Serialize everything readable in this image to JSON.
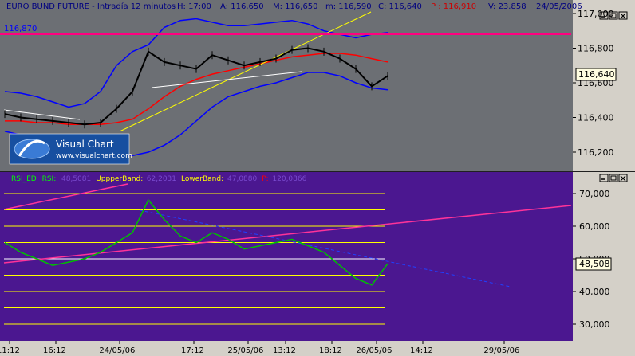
{
  "top_panel": {
    "title": "EURO BUND FUTURE - Intradía 12 minutos",
    "stats": [
      {
        "label": "H:",
        "value": "17:00",
        "color": "#000080"
      },
      {
        "label": "A:",
        "value": "116,650",
        "color": "#000080"
      },
      {
        "label": "M:",
        "value": "116,650",
        "color": "#000080"
      },
      {
        "label": "m:",
        "value": "116,590",
        "color": "#000080"
      },
      {
        "label": "C:",
        "value": "116,640",
        "color": "#000080"
      },
      {
        "label": "P :",
        "value": "116,910",
        "color": "#cc0000"
      },
      {
        "label": "V:",
        "value": "23.858",
        "color": "#000080"
      },
      {
        "label": "",
        "value": "24/05/2006",
        "color": "#000080"
      }
    ],
    "hline_label": "116,870",
    "current_price_label": "116,640",
    "yaxis_ticks": [
      "117,000",
      "116,800",
      "116,600",
      "116,400",
      "116,200"
    ],
    "logo_title": "Visual Chart",
    "logo_url": "www.visualchart.com",
    "colors": {
      "background": "#6c6f74",
      "hline": "#ff0080",
      "upper_band": "#0000ff",
      "ma": "#ff0000",
      "trend": "#ffff00"
    }
  },
  "bottom_panel": {
    "legend": [
      {
        "label": "RSI_ED",
        "value": "",
        "color": "#00ff00"
      },
      {
        "label": "RSI:",
        "value": "48,5081",
        "color": "#00ff00"
      },
      {
        "label": "UppperBand:",
        "value": "62,2031",
        "color": "#ffff00"
      },
      {
        "label": "LowerBand:",
        "value": "47,0880",
        "color": "#ffff00"
      },
      {
        "label": "P:",
        "value": "120,0866",
        "color": "#ff0000"
      }
    ],
    "current_value_label": "48,508",
    "yaxis_ticks": [
      "70,000",
      "60,000",
      "50,000",
      "40,000",
      "30,000"
    ],
    "colors": {
      "background": "#4b1790",
      "rsi": "#00c000",
      "levels": "#ffff00"
    }
  },
  "xaxis_ticks": [
    "11:12",
    "16:12",
    "24/05/06",
    "17:12",
    "25/05/06",
    "13:12",
    "18:12",
    "26/05/06",
    "14:12",
    "29/05/06"
  ],
  "chart_data": [
    {
      "type": "line",
      "title": "EURO BUND FUTURE - Intradía 12 minutos",
      "series": [
        {
          "name": "price",
          "x": [
            0,
            20,
            40,
            60,
            80,
            100,
            120,
            140,
            160,
            180,
            200,
            220,
            240,
            260,
            280,
            300,
            320,
            340,
            360,
            380,
            400,
            420,
            440,
            460,
            480
          ],
          "values": [
            116.42,
            116.4,
            116.39,
            116.38,
            116.37,
            116.36,
            116.37,
            116.45,
            116.55,
            116.78,
            116.72,
            116.7,
            116.68,
            116.76,
            116.73,
            116.7,
            116.72,
            116.74,
            116.79,
            116.8,
            116.78,
            116.74,
            116.68,
            116.58,
            116.64
          ]
        }
      ],
      "yaxis_range": [
        116.1,
        117.0
      ],
      "reference_line": 116.87
    },
    {
      "type": "line",
      "series": [
        {
          "name": "RSI",
          "x": [
            0,
            20,
            40,
            60,
            80,
            100,
            120,
            140,
            160,
            180,
            200,
            220,
            240,
            260,
            280,
            300,
            320,
            340,
            360,
            380,
            400,
            420,
            440,
            460,
            480
          ],
          "values": [
            55,
            52,
            50,
            48,
            49,
            50,
            52,
            55,
            58,
            68,
            62,
            57,
            55,
            58,
            56,
            53,
            54,
            55,
            56,
            54,
            52,
            48,
            44,
            42,
            48.5
          ]
        }
      ],
      "yaxis_range": [
        25,
        73
      ],
      "levels": [
        70,
        65,
        60,
        55,
        50,
        45,
        40,
        35,
        30
      ]
    }
  ]
}
